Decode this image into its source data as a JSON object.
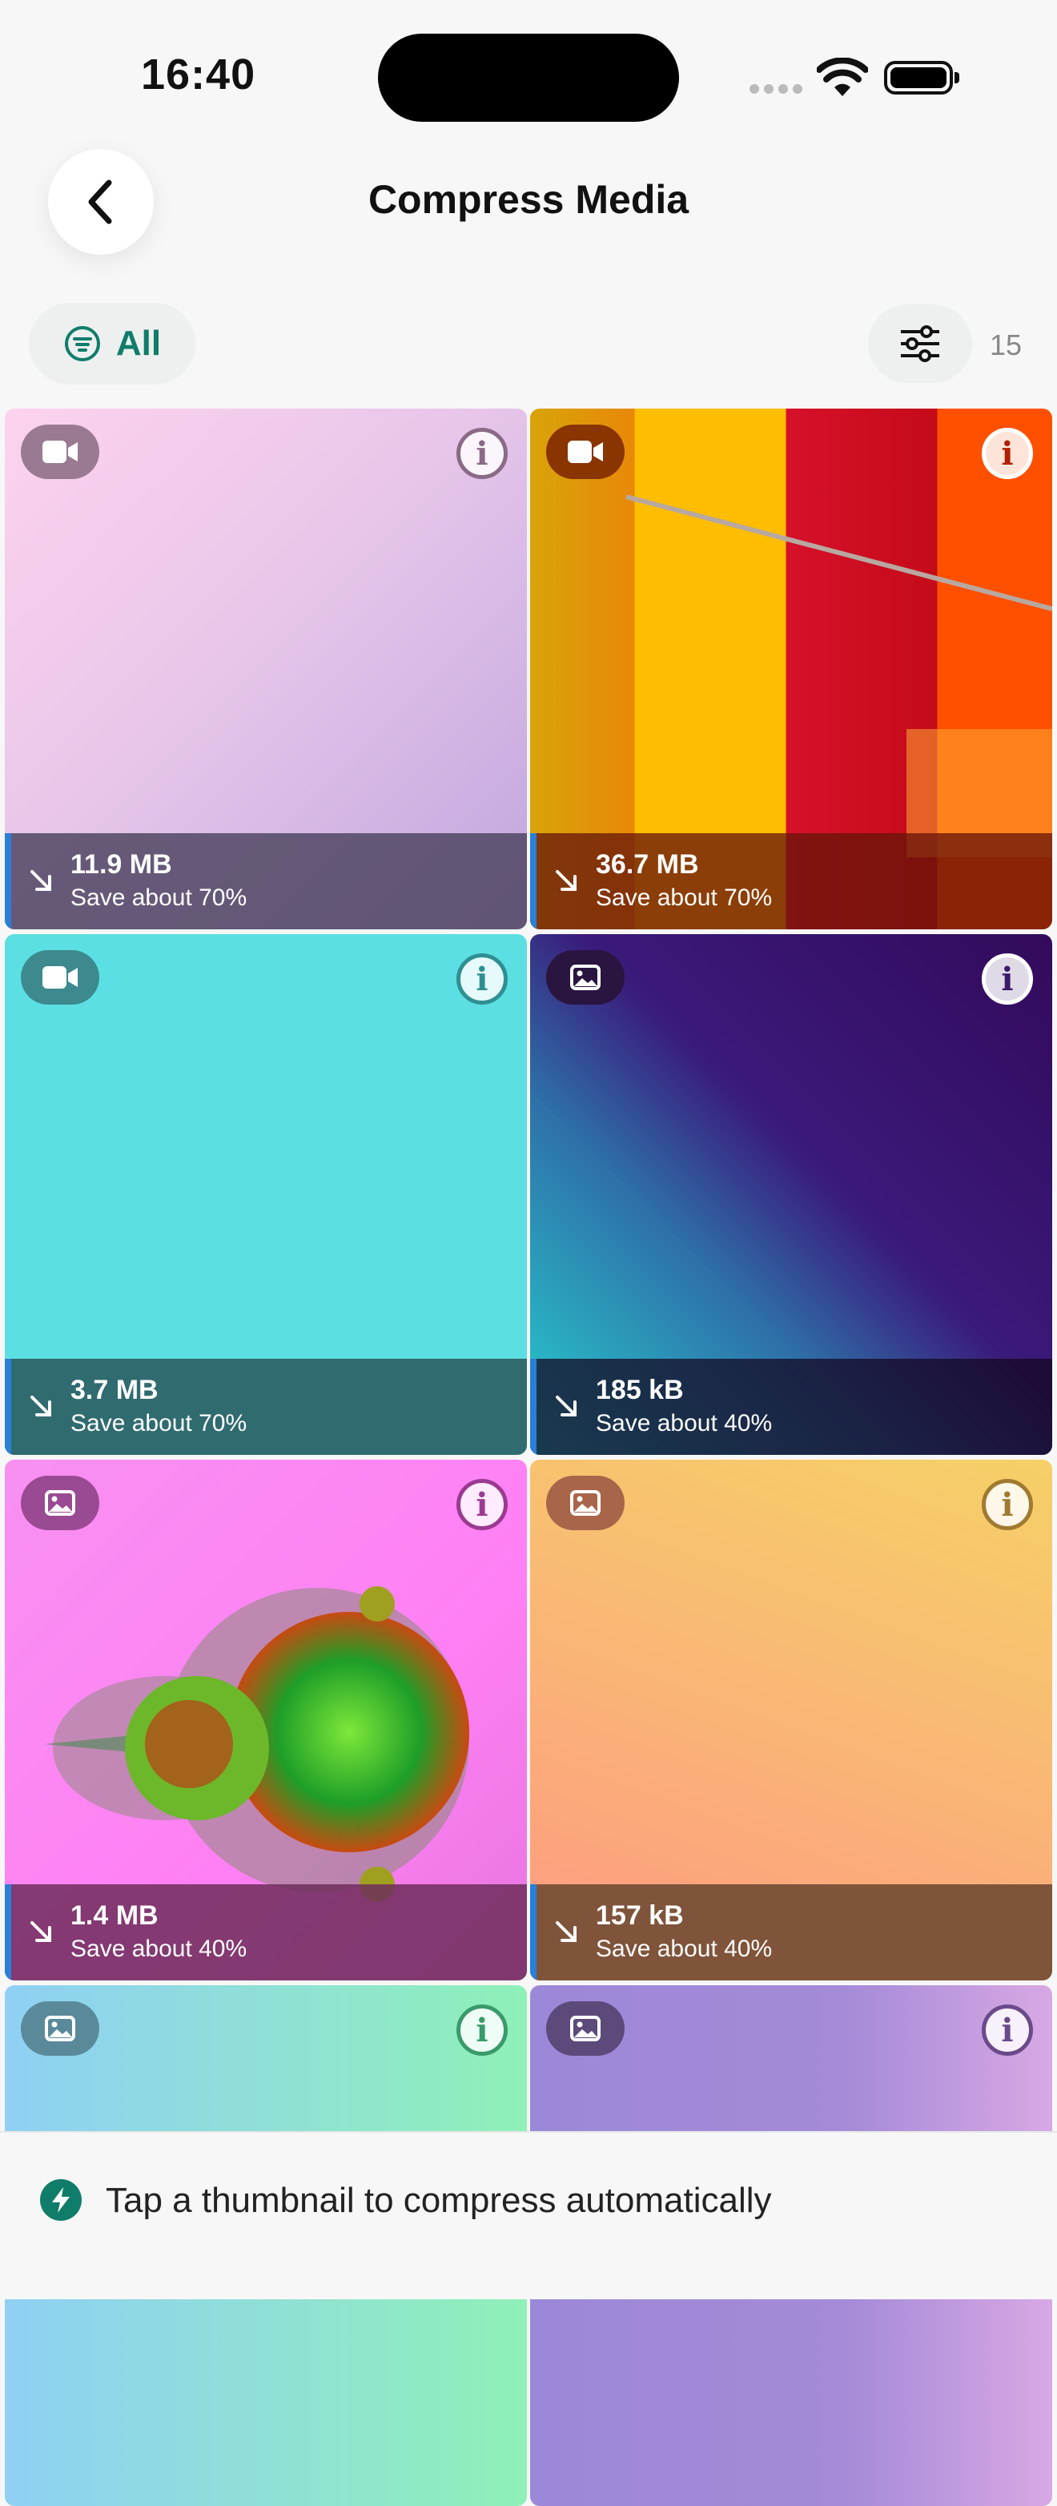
{
  "status_bar": {
    "time": "16:40"
  },
  "header": {
    "title": "Compress Media",
    "back_icon": "chevron-left-icon"
  },
  "filters": {
    "all_label": "All",
    "count": "15",
    "settings_icon": "sliders-icon"
  },
  "tiles": [
    {
      "type": "video",
      "size": "11.9 MB",
      "save": "Save about 70%"
    },
    {
      "type": "video",
      "size": "36.7 MB",
      "save": "Save about 70%"
    },
    {
      "type": "video",
      "size": "3.7 MB",
      "save": "Save about 70%"
    },
    {
      "type": "image",
      "size": "185 kB",
      "save": "Save about 40%"
    },
    {
      "type": "image",
      "size": "1.4 MB",
      "save": "Save about 40%"
    },
    {
      "type": "image",
      "size": "157 kB",
      "save": "Save about 40%"
    },
    {
      "type": "image",
      "size": "",
      "save": ""
    },
    {
      "type": "image",
      "size": "",
      "save": ""
    }
  ],
  "footer": {
    "hint": "Tap a thumbnail to compress automatically"
  },
  "colors": {
    "accent": "#0f7d6a",
    "bar_accent": "#2a7fd6"
  }
}
